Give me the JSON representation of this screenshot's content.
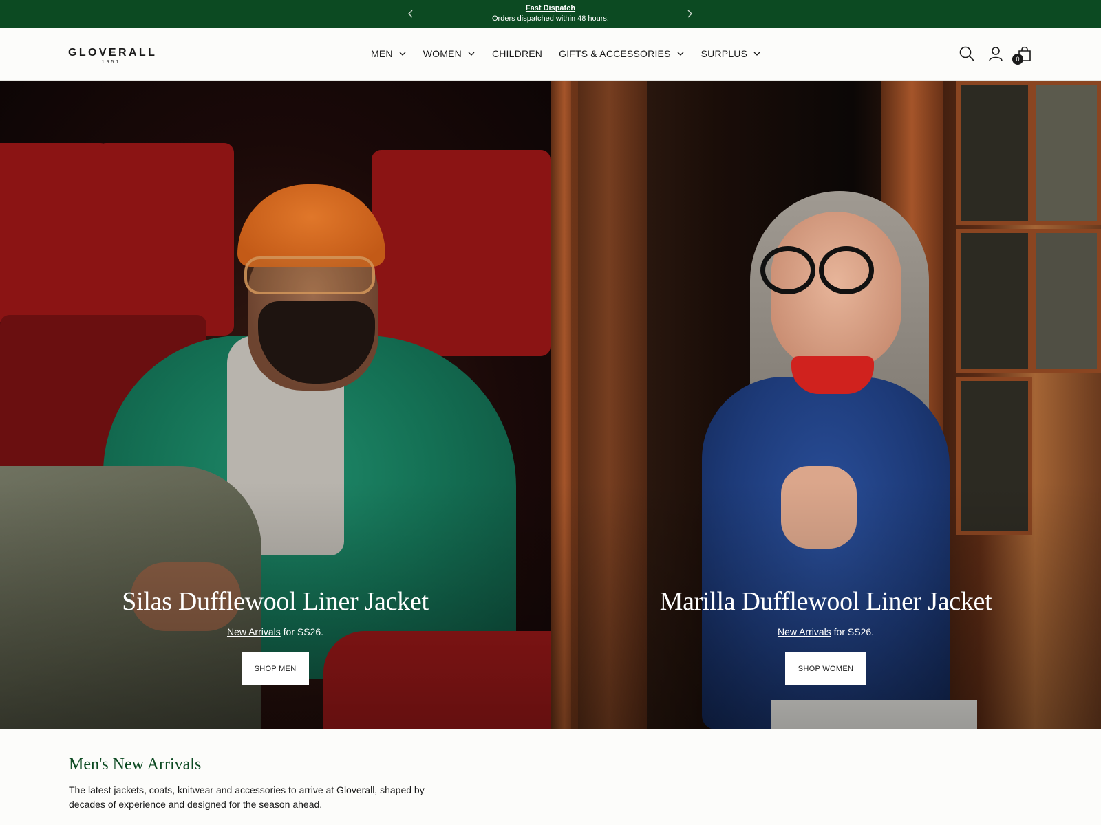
{
  "announcement": {
    "title": "Fast Dispatch",
    "message": "Orders dispatched within 48 hours.",
    "prev_icon": "chevron-left-icon",
    "next_icon": "chevron-right-icon"
  },
  "brand": {
    "name": "GLOVERALL",
    "year": "1951"
  },
  "nav": {
    "items": [
      {
        "label": "MEN",
        "has_dropdown": true
      },
      {
        "label": "WOMEN",
        "has_dropdown": true
      },
      {
        "label": "CHILDREN",
        "has_dropdown": false
      },
      {
        "label": "GIFTS & ACCESSORIES",
        "has_dropdown": true
      },
      {
        "label": "SURPLUS",
        "has_dropdown": true
      }
    ]
  },
  "header_icons": {
    "search": "search-icon",
    "account": "account-icon",
    "cart": "cart-icon",
    "cart_count": "0"
  },
  "hero": {
    "men": {
      "title": "Silas Dufflewool Liner Jacket",
      "link_text": "New Arrivals",
      "sub_text": " for SS26.",
      "button": "SHOP MEN"
    },
    "women": {
      "title": "Marilla Dufflewool Liner Jacket",
      "link_text": "New Arrivals",
      "sub_text": " for SS26.",
      "button": "SHOP WOMEN"
    }
  },
  "arrivals": {
    "heading": "Men's New Arrivals",
    "description": "The latest jackets, coats, knitwear and accessories to arrive at Gloverall, shaped by decades of experience and designed for the season ahead."
  },
  "colors": {
    "brand_green": "#0c4a22",
    "background": "#fcfcfa",
    "text": "#1a1a1a"
  }
}
